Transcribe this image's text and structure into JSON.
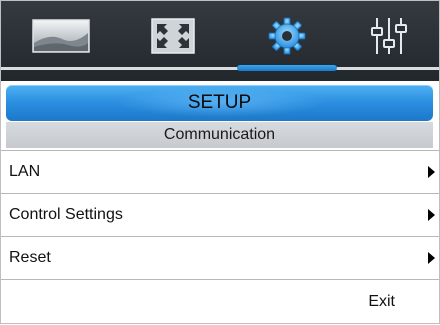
{
  "tabs": [
    {
      "name": "picture",
      "icon": "picture-icon"
    },
    {
      "name": "display",
      "icon": "fullscreen-icon"
    },
    {
      "name": "setup",
      "icon": "gear-icon",
      "active": true
    },
    {
      "name": "adjust",
      "icon": "sliders-icon"
    }
  ],
  "colors": {
    "accent": "#2a8ee0",
    "topbar": "#2b3036"
  },
  "header": {
    "title": "SETUP"
  },
  "subheader": {
    "title": "Communication"
  },
  "menu": {
    "items": [
      {
        "label": "LAN"
      },
      {
        "label": "Control Settings"
      },
      {
        "label": "Reset"
      }
    ],
    "exit_label": "Exit"
  }
}
